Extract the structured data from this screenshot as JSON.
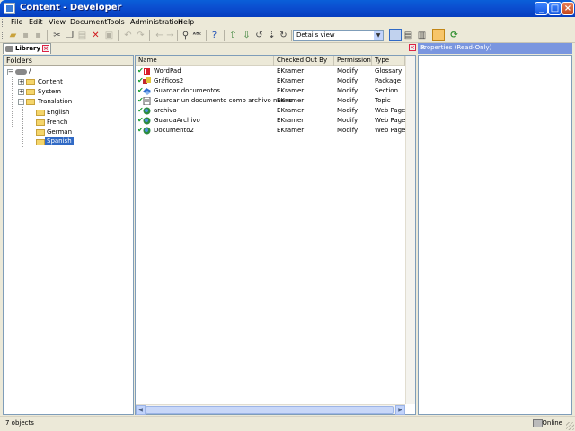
{
  "window": {
    "title": "Content - Developer"
  },
  "menu": [
    "File",
    "Edit",
    "View",
    "Document",
    "Tools",
    "Administration",
    "Help"
  ],
  "toolbar": {
    "view_mode": "Details view"
  },
  "library": {
    "tab_label": "Library",
    "folders_header": "Folders",
    "tree": {
      "root": "/",
      "content": "Content",
      "system": "System",
      "translation": "Translation",
      "english": "English",
      "french": "French",
      "german": "German",
      "spanish": "Spanish"
    },
    "columns": [
      "Name",
      "Checked Out By",
      "Permission",
      "Type"
    ],
    "rows": [
      {
        "name": "WordPad",
        "checked_out_by": "EKramer",
        "permission": "Modify",
        "type": "Glossary",
        "icon": "glossary-icon"
      },
      {
        "name": "Gráficos2",
        "checked_out_by": "EKramer",
        "permission": "Modify",
        "type": "Package",
        "icon": "package-icon"
      },
      {
        "name": "Guardar documentos",
        "checked_out_by": "EKramer",
        "permission": "Modify",
        "type": "Section",
        "icon": "section-icon"
      },
      {
        "name": "Guardar un documento como archivo nuevo",
        "checked_out_by": "EKramer",
        "permission": "Modify",
        "type": "Topic",
        "icon": "topic-icon"
      },
      {
        "name": "archivo",
        "checked_out_by": "EKramer",
        "permission": "Modify",
        "type": "Web Page",
        "icon": "web-page-icon"
      },
      {
        "name": "GuardaArchivo",
        "checked_out_by": "EKramer",
        "permission": "Modify",
        "type": "Web Page",
        "icon": "web-page-icon"
      },
      {
        "name": "Documento2",
        "checked_out_by": "EKramer",
        "permission": "Modify",
        "type": "Web Page",
        "icon": "web-page-icon"
      }
    ]
  },
  "properties": {
    "title": "Properties (Read-Only)"
  },
  "status": {
    "left": "7 objects",
    "right": "Online"
  }
}
